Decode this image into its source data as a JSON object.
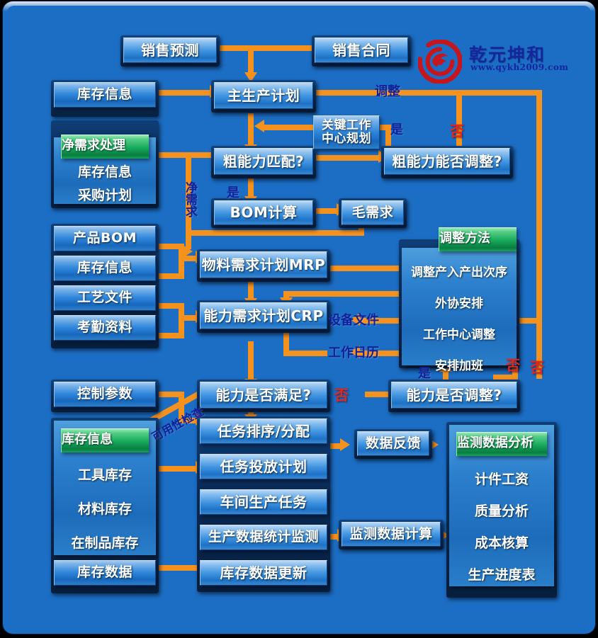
{
  "theme": {
    "bg": "#1c6ec4",
    "connector": "#F5921E",
    "yes_label_color": "#10209a",
    "no_label_color": "#E8241B",
    "green": "#15a85a"
  },
  "logo": {
    "brand": "乾元坤和",
    "url": "www.qykh2009.com"
  },
  "nodes": {
    "sales_forecast": "销售预测",
    "sales_contract": "销售合同",
    "inventory_info_top": "库存信息",
    "master_plan": "主生产计划",
    "key_wc_plan_l1": "关键工作",
    "key_wc_plan_l2": "中心规划",
    "rough_cap_match": "粗能力匹配?",
    "rough_cap_adjust": "粗能力能否调整?",
    "bom_calc": "BOM计算",
    "gross_req": "毛需求",
    "mrp": "物料需求计划MRP",
    "crp": "能力需求计划CRP",
    "product_bom": "产品BOM",
    "inventory_info_2": "库存信息",
    "process_file": "工艺文件",
    "attendance": "考勤资料",
    "control_param": "控制参数",
    "cap_satisfy": "能力是否满足?",
    "cap_adjust": "能力是否调整?",
    "task_seq": "任务排序/分配",
    "task_release": "任务投放计划",
    "workshop_task": "车间生产任务",
    "prod_data_stat": "生产数据统计监测",
    "inv_data_update": "库存数据更新",
    "data_feedback": "数据反馈",
    "monitor_calc": "监测数据计算",
    "inventory_data": "库存数据"
  },
  "groups": {
    "net_req": {
      "header": "净需求处理",
      "items": [
        "库存信息",
        "采购计划"
      ]
    },
    "adjust_methods": {
      "header": "调整方法",
      "items": [
        "调整产入产出次序",
        "外协安排",
        "工作中心调整",
        "安排加班"
      ]
    },
    "inventory_panel": {
      "header": "库存信息",
      "items": [
        "工具库存",
        "材料库存",
        "在制品库存"
      ]
    },
    "monitor_panel": {
      "header": "监测数据分析",
      "items": [
        "计件工资",
        "质量分析",
        "成本核算",
        "生产进度表"
      ]
    }
  },
  "edge_labels": {
    "adjust": "调整",
    "no_1": "否",
    "no_2": "否",
    "no_3": "否",
    "no_4": "否",
    "yes_1": "是",
    "yes_2": "是",
    "yes_3": "是",
    "net_req_vertical": "净需求",
    "equipment_file": "设备文件",
    "work_calendar": "工作日历",
    "availability_check": "可用性检查"
  }
}
